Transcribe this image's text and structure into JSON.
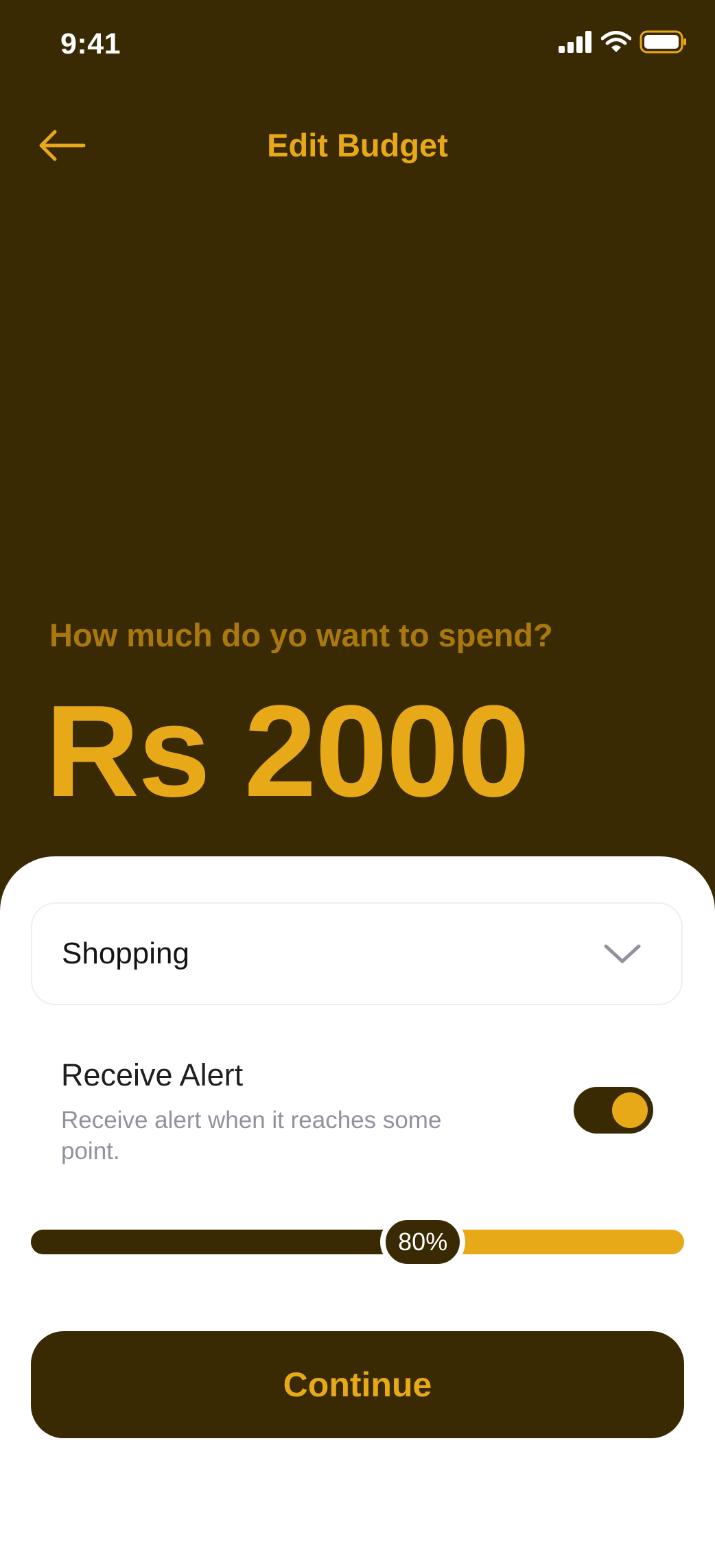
{
  "status_bar": {
    "time": "9:41",
    "icons": [
      "cellular-signal-icon",
      "wifi-icon",
      "battery-icon"
    ]
  },
  "header": {
    "back_icon": "arrow-left-icon",
    "title": "Edit Budget"
  },
  "budget": {
    "question": "How much do yo want to spend?",
    "amount": "Rs 2000"
  },
  "form": {
    "category": {
      "selected": "Shopping",
      "icon": "chevron-down-icon"
    },
    "alert": {
      "title": "Receive Alert",
      "description": "Receive alert when it reaches some point.",
      "enabled": true
    },
    "alert_threshold": {
      "label": "80%",
      "percent": 60
    },
    "continue_label": "Continue"
  },
  "colors": {
    "brand_dark": "#3a2a03",
    "accent": "#e8a919",
    "muted_text": "#91919f"
  }
}
